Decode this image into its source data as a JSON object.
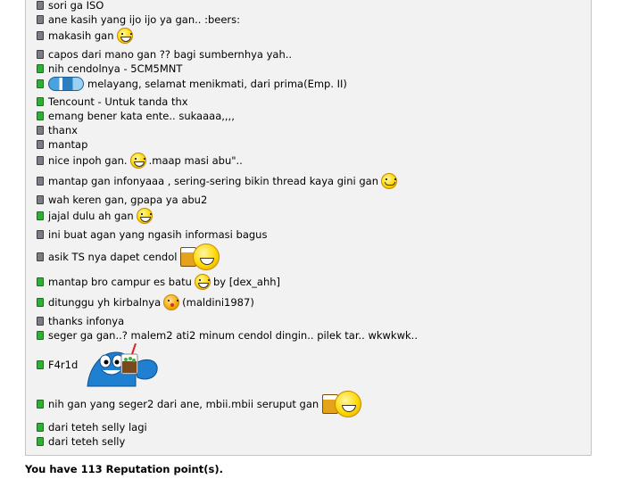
{
  "reputation_list": {
    "items": [
      {
        "text": "sori ga ISO",
        "color": "grey"
      },
      {
        "text": "ane kasih yang ijo ijo ya gan.. :beers:",
        "color": "grey"
      },
      {
        "text": "makasih gan",
        "color": "grey",
        "after_icon": "grin-smiley-icon"
      },
      {
        "text": "capos dari mano gan ?? bagi sumbernhya yah..",
        "color": "grey"
      },
      {
        "text": "nih cendolnya - 5CM5MNT",
        "color": "green"
      },
      {
        "text": "melayang, selamat menikmati, dari prima(Emp. II)",
        "color": "green",
        "before_icon": "wave-icon"
      },
      {
        "text": "Tencount - Untuk tanda thx",
        "color": "green"
      },
      {
        "text": "emang bener kata ente.. sukaaaa,,,,",
        "color": "green"
      },
      {
        "text": "thanx",
        "color": "grey"
      },
      {
        "text": "mantap",
        "color": "grey"
      },
      {
        "text_before": "nice inpoh gan.",
        "text_after": " .maap masi abu\"..",
        "color": "grey",
        "mid_icon": "grin-smiley-icon"
      },
      {
        "text": "mantap gan infonyaaa , sering-sering bikin thread kaya gini gan",
        "color": "grey",
        "after_icon": "smile-icon"
      },
      {
        "text": "wah keren gan, gpapa ya abu2",
        "color": "grey"
      },
      {
        "text": "jajal dulu ah gan",
        "color": "green",
        "after_icon": "grin-smiley-icon"
      },
      {
        "text": "ini buat agan yang ngasih informasi bagus",
        "color": "grey"
      },
      {
        "text": "asik TS nya dapet cendol",
        "color": "grey",
        "after_icon": "beer-cheers-icon"
      },
      {
        "text_before": "mantap bro campur es batu",
        "text_after": " by [dex_ahh]",
        "color": "green",
        "mid_icon": "grin-smiley-icon"
      },
      {
        "text_before": "ditunggu yh kirbalnya",
        "text_after": " (maldini1987)",
        "color": "green",
        "mid_icon": "kiss-smiley-icon"
      },
      {
        "text": "thanks infonya",
        "color": "grey"
      },
      {
        "text": "seger ga gan..? malem2 ati2 minum cendol dingin.. pilek tar.. wkwkwk..",
        "color": "green"
      },
      {
        "text": "F4r1d",
        "color": "green",
        "after_icon": "cendol-mascot-icon"
      },
      {
        "text": "nih gan yang seger2 dari ane, mbii.mbii seruput gan",
        "color": "green",
        "after_icon": "beer-cheers-icon"
      },
      {
        "text": "dari teteh selly lagi",
        "color": "green"
      },
      {
        "text": "dari teteh selly",
        "color": "green"
      }
    ]
  },
  "footer": {
    "reputation_text": "You have 113 Reputation point(s)."
  },
  "colors": {
    "panel_bg": "#f2f2f2",
    "panel_border": "#c5c5c5",
    "positive_square": "#2fb035",
    "neutral_square": "#7c7c84"
  }
}
